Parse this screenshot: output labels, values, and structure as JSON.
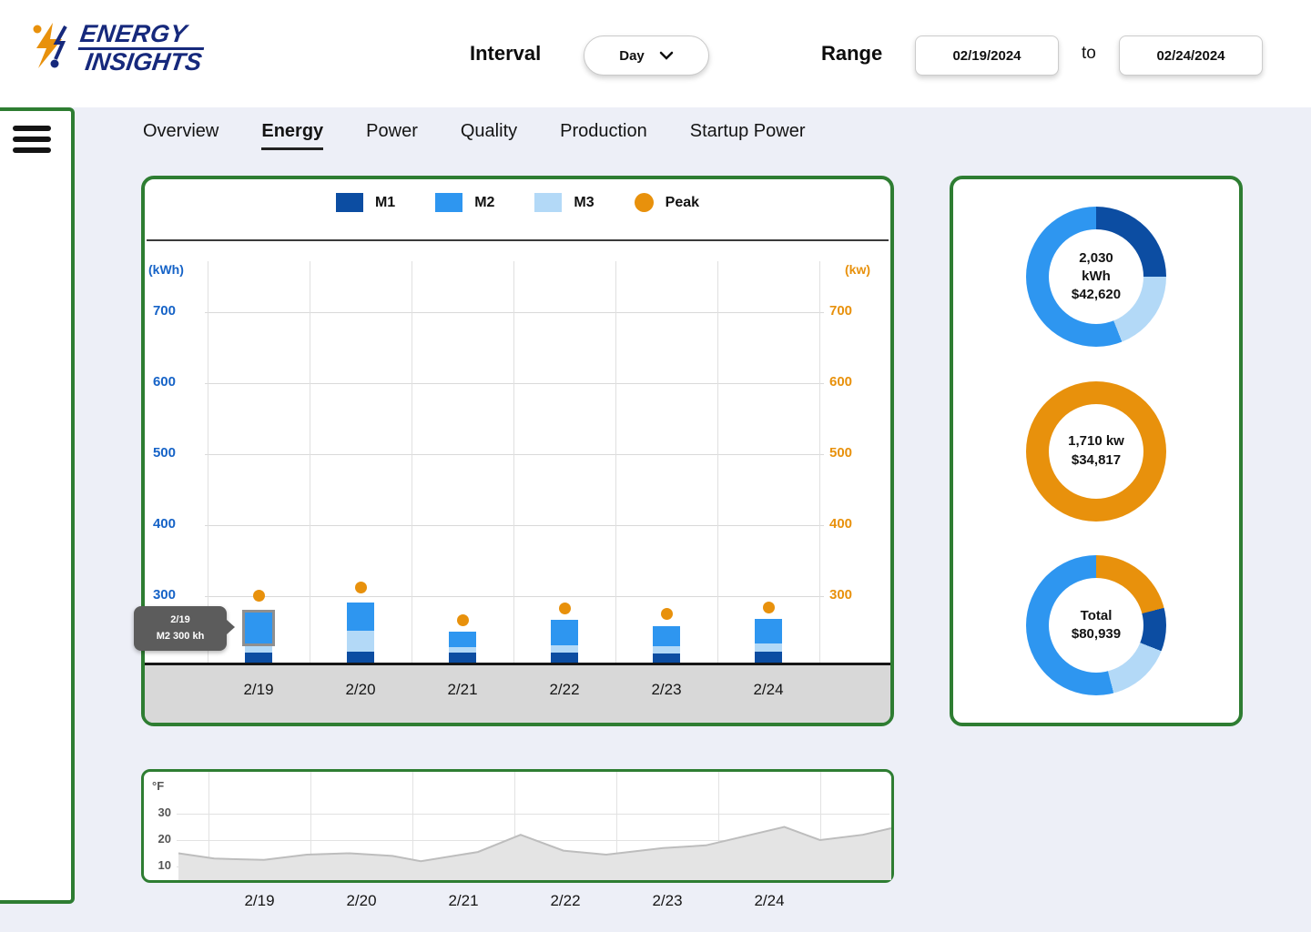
{
  "header": {
    "logo_line1": "ENERGY",
    "logo_line2": "INSIGHTS",
    "interval_label": "Interval",
    "interval_value": "Day",
    "range_label": "Range",
    "range_from": "02/19/2024",
    "to_label": "to",
    "range_to": "02/24/2024"
  },
  "tabs": {
    "items": [
      {
        "label": "Overview",
        "active": false
      },
      {
        "label": "Energy",
        "active": true
      },
      {
        "label": "Power",
        "active": false
      },
      {
        "label": "Quality",
        "active": false
      },
      {
        "label": "Production",
        "active": false
      },
      {
        "label": "Startup Power",
        "active": false
      }
    ]
  },
  "colors": {
    "green_border": "#2e7d32",
    "m1": "#0c4da2",
    "m2": "#2e96f0",
    "m3": "#b3d9f7",
    "peak": "#e8910c",
    "axis_left_blue": "#1663c7",
    "axis_right_orange": "#e8910c",
    "background": "#edeff7",
    "band_gray": "#d8d8d8",
    "tooltip_gray": "#5c5c5c"
  },
  "chart_data": [
    {
      "type": "bar",
      "id": "energy-by-day",
      "categories": [
        "2/19",
        "2/20",
        "2/21",
        "2/22",
        "2/23",
        "2/24"
      ],
      "stack_order_bottom_to_top": [
        "M1",
        "M3",
        "M2"
      ],
      "series": [
        {
          "name": "M1",
          "color_key": "m1",
          "values": [
            14,
            15,
            14,
            14,
            13,
            15
          ]
        },
        {
          "name": "M3",
          "color_key": "m3",
          "values": [
            13,
            30,
            8,
            10,
            10,
            12
          ]
        },
        {
          "name": "M2",
          "color_key": "m2",
          "values": [
            44,
            40,
            22,
            36,
            28,
            35
          ]
        }
      ],
      "peak_series": {
        "name": "Peak",
        "color_key": "peak",
        "values": [
          300,
          312,
          265,
          282,
          274,
          283
        ]
      },
      "legend": [
        {
          "label": "M1",
          "color_key": "m1",
          "shape": "square"
        },
        {
          "label": "M2",
          "color_key": "m2",
          "shape": "square"
        },
        {
          "label": "M3",
          "color_key": "m3",
          "shape": "square"
        },
        {
          "label": "Peak",
          "color_key": "peak",
          "shape": "circle"
        }
      ],
      "y_left_label": "(kWh)",
      "y_right_label": "(kw)",
      "yticks": [
        700,
        600,
        500,
        400,
        300
      ],
      "ylim": [
        206,
        716
      ],
      "grid": true,
      "highlight": {
        "category_index": 0,
        "series": "M2"
      },
      "tooltip": {
        "line1": "2/19",
        "line2": "M2 300 kh"
      }
    },
    {
      "type": "donut",
      "id": "energy-total",
      "center_lines": [
        "2,030",
        "kWh",
        "$42,620"
      ],
      "segments": [
        {
          "label": "M1",
          "color_key": "m1",
          "pct": 25
        },
        {
          "label": "M3",
          "color_key": "m3",
          "pct": 19
        },
        {
          "label": "M2",
          "color_key": "m2",
          "pct": 56
        }
      ]
    },
    {
      "type": "donut",
      "id": "power-total",
      "center_lines": [
        "1,710 kw",
        "$34,817"
      ],
      "segments": [
        {
          "label": "Peak",
          "color_key": "peak",
          "pct": 100
        }
      ]
    },
    {
      "type": "donut",
      "id": "cost-total",
      "center_lines": [
        "Total",
        "$80,939"
      ],
      "segments": [
        {
          "label": "Peak",
          "color_key": "peak",
          "pct": 21
        },
        {
          "label": "M1",
          "color_key": "m1",
          "pct": 10
        },
        {
          "label": "M3",
          "color_key": "m3",
          "pct": 15
        },
        {
          "label": "M2",
          "color_key": "m2",
          "pct": 54
        }
      ]
    },
    {
      "type": "area",
      "id": "temperature",
      "ylabel": "°F",
      "yticks": [
        30,
        20,
        10
      ],
      "ylim": [
        5,
        45
      ],
      "categories": [
        "2/19",
        "2/20",
        "2/21",
        "2/22",
        "2/23",
        "2/24"
      ],
      "points": [
        [
          0,
          15
        ],
        [
          0.05,
          13
        ],
        [
          0.12,
          12.5
        ],
        [
          0.18,
          14.5
        ],
        [
          0.24,
          15
        ],
        [
          0.3,
          14
        ],
        [
          0.34,
          12
        ],
        [
          0.42,
          15.5
        ],
        [
          0.48,
          22
        ],
        [
          0.54,
          16
        ],
        [
          0.6,
          14.5
        ],
        [
          0.68,
          17
        ],
        [
          0.74,
          18
        ],
        [
          0.85,
          25
        ],
        [
          0.9,
          20
        ],
        [
          0.96,
          22
        ],
        [
          1,
          24.5
        ]
      ]
    }
  ]
}
